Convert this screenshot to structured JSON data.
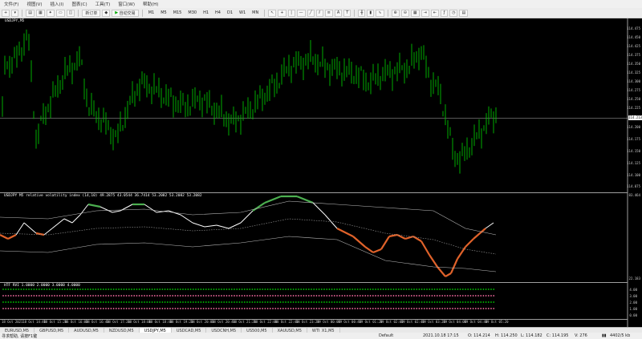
{
  "menu": [
    "文件(F)",
    "视图(V)",
    "插入(I)",
    "图表(C)",
    "工具(T)",
    "窗口(W)",
    "帮助(H)"
  ],
  "toolbar": {
    "new_order": "新订单",
    "autotrade": "自动交易",
    "timeframes": [
      "M1",
      "M5",
      "M15",
      "M30",
      "H1",
      "H4",
      "D1",
      "W1",
      "MN"
    ]
  },
  "chart": {
    "title": "USDJPY,M5",
    "current_price": "114.213",
    "price_scale": [
      "114.475",
      "114.450",
      "114.425",
      "114.400",
      "114.375",
      "114.350",
      "114.325",
      "114.300",
      "114.275",
      "114.250",
      "114.225",
      "114.200",
      "114.175",
      "114.150",
      "114.125",
      "114.100",
      "114.075"
    ]
  },
  "indicator1": {
    "title": "USDJPY M5 relative volatility index (14,10) 49.2875 43.0544 36.7414 53.2082 53.2082 53.2082",
    "scale_top": "83.464",
    "scale_bottom": "22.183"
  },
  "indicator2": {
    "title": "HTF RVI 1.0000 2.0000 3.0000 4.0000",
    "scale": [
      "4.00",
      "3.00",
      "2.00",
      "1.00",
      "0.00"
    ]
  },
  "time_axis": [
    "18 Oct 2021",
    "18 Oct 14:40",
    "18 Oct 15:20",
    "18 Oct 16:00",
    "18 Oct 16:40",
    "18 Oct 17:20",
    "18 Oct 18:00",
    "18 Oct 18:40",
    "18 Oct 19:20",
    "18 Oct 20:00",
    "18 Oct 20:40",
    "18 Oct 21:20",
    "18 Oct 22:00",
    "18 Oct 22:40",
    "18 Oct 23:20",
    "19 Oct 00:00",
    "19 Oct 00:40",
    "19 Oct 01:20",
    "19 Oct 02:00",
    "19 Oct 02:40",
    "19 Oct 03:20",
    "19 Oct 04:00",
    "19 Oct 04:40",
    "19 Oct 05:20"
  ],
  "tabs": [
    "EURUSD,M5",
    "GBPUSD,M5",
    "AUDUSD,M5",
    "NZDUSD,M5",
    "USDJPY,M5",
    "USDCAD,M5",
    "USDCNH,M5",
    "US500,M5",
    "XAUUSD,M5",
    "WTI_X1,M5"
  ],
  "active_tab": "USDJPY,M5",
  "status": {
    "help": "寻求帮助, 请按F1键",
    "profile": "Default",
    "datetime": "2021.10.18 17:15",
    "open": "O: 114.214",
    "high": "H: 114.250",
    "low": "L: 114.182",
    "close": "C: 114.195",
    "volume": "V: 276",
    "traffic": "4402/5 kb"
  },
  "colors": {
    "bull": "#00c000",
    "line_up": "#4caf50",
    "line_down": "#e0622a",
    "dot_pink": "#ff6fa8",
    "dot_green": "#00d000"
  }
}
